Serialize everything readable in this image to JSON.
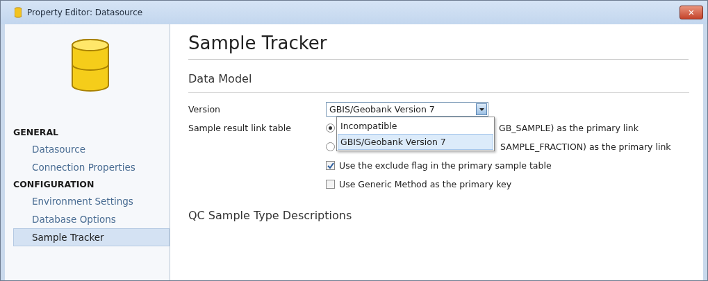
{
  "window": {
    "title": "Property Editor:  Datasource",
    "close": "×"
  },
  "sidebar": {
    "sections": [
      {
        "heading": "GENERAL",
        "items": [
          {
            "label": "Datasource",
            "selected": false
          },
          {
            "label": "Connection Properties",
            "selected": false
          }
        ]
      },
      {
        "heading": "CONFIGURATION",
        "items": [
          {
            "label": "Environment Settings",
            "selected": false
          },
          {
            "label": "Database Options",
            "selected": false
          },
          {
            "label": "Sample Tracker",
            "selected": true
          }
        ]
      }
    ]
  },
  "page_title": "Sample Tracker",
  "sections": [
    {
      "title": "Data Model"
    },
    {
      "title": "QC Sample Type Descriptions"
    }
  ],
  "version": {
    "label": "Version",
    "value": "GBIS/Geobank Version 7",
    "expanded": true,
    "options": [
      {
        "label": "Incompatible",
        "selected": false
      },
      {
        "label": "GBIS/Geobank Version 7",
        "selected": true
      }
    ]
  },
  "link_table": {
    "label": "Sample result link table",
    "options": [
      {
        "text": "GB_SAMPLE) as the primary link",
        "selected": true
      },
      {
        "text": "SAMPLE_FRACTION) as the primary link",
        "selected": false
      }
    ]
  },
  "checkboxes": [
    {
      "label": "Use the exclude flag in the primary sample table",
      "checked": true
    },
    {
      "label": "Use Generic Method as the primary key",
      "checked": false
    }
  ]
}
